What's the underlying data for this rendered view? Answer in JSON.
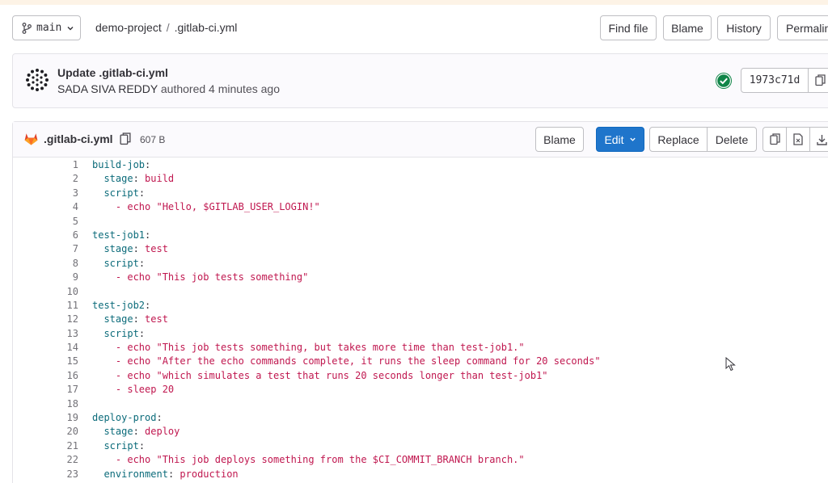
{
  "branch": {
    "name": "main"
  },
  "breadcrumb": {
    "project": "demo-project",
    "separator": "/",
    "file": ".gitlab-ci.yml"
  },
  "header_buttons": {
    "find_file": "Find file",
    "blame": "Blame",
    "history": "History",
    "permalink": "Permalink"
  },
  "commit": {
    "title": "Update .gitlab-ci.yml",
    "author": "SADA SIVA REDDY",
    "authored_text": "authored 4 minutes ago",
    "sha": "1973c71d",
    "status": "passed",
    "status_color": "#108548"
  },
  "file": {
    "name": ".gitlab-ci.yml",
    "size": "607 B",
    "buttons": {
      "blame": "Blame",
      "edit": "Edit",
      "replace": "Replace",
      "delete": "Delete"
    }
  },
  "code_lines": [
    {
      "n": "1",
      "indent": "",
      "key": "build-job",
      "sep": ":",
      "val": ""
    },
    {
      "n": "2",
      "indent": "  ",
      "key": "stage",
      "sep": ": ",
      "val": "build"
    },
    {
      "n": "3",
      "indent": "  ",
      "key": "script",
      "sep": ":",
      "val": ""
    },
    {
      "n": "4",
      "indent": "    ",
      "key": "",
      "sep": "- ",
      "val": "echo \"Hello, $GITLAB_USER_LOGIN!\""
    },
    {
      "n": "5",
      "indent": "",
      "key": "",
      "sep": "",
      "val": ""
    },
    {
      "n": "6",
      "indent": "",
      "key": "test-job1",
      "sep": ":",
      "val": ""
    },
    {
      "n": "7",
      "indent": "  ",
      "key": "stage",
      "sep": ": ",
      "val": "test"
    },
    {
      "n": "8",
      "indent": "  ",
      "key": "script",
      "sep": ":",
      "val": ""
    },
    {
      "n": "9",
      "indent": "    ",
      "key": "",
      "sep": "- ",
      "val": "echo \"This job tests something\""
    },
    {
      "n": "10",
      "indent": "",
      "key": "",
      "sep": "",
      "val": ""
    },
    {
      "n": "11",
      "indent": "",
      "key": "test-job2",
      "sep": ":",
      "val": ""
    },
    {
      "n": "12",
      "indent": "  ",
      "key": "stage",
      "sep": ": ",
      "val": "test"
    },
    {
      "n": "13",
      "indent": "  ",
      "key": "script",
      "sep": ":",
      "val": ""
    },
    {
      "n": "14",
      "indent": "    ",
      "key": "",
      "sep": "- ",
      "val": "echo \"This job tests something, but takes more time than test-job1.\""
    },
    {
      "n": "15",
      "indent": "    ",
      "key": "",
      "sep": "- ",
      "val": "echo \"After the echo commands complete, it runs the sleep command for 20 seconds\""
    },
    {
      "n": "16",
      "indent": "    ",
      "key": "",
      "sep": "- ",
      "val": "echo \"which simulates a test that runs 20 seconds longer than test-job1\""
    },
    {
      "n": "17",
      "indent": "    ",
      "key": "",
      "sep": "- ",
      "val": "sleep 20"
    },
    {
      "n": "18",
      "indent": "",
      "key": "",
      "sep": "",
      "val": ""
    },
    {
      "n": "19",
      "indent": "",
      "key": "deploy-prod",
      "sep": ":",
      "val": ""
    },
    {
      "n": "20",
      "indent": "  ",
      "key": "stage",
      "sep": ": ",
      "val": "deploy"
    },
    {
      "n": "21",
      "indent": "  ",
      "key": "script",
      "sep": ":",
      "val": ""
    },
    {
      "n": "22",
      "indent": "    ",
      "key": "",
      "sep": "- ",
      "val": "echo \"This job deploys something from the $CI_COMMIT_BRANCH branch.\""
    },
    {
      "n": "23",
      "indent": "  ",
      "key": "environment",
      "sep": ": ",
      "val": "production"
    }
  ]
}
